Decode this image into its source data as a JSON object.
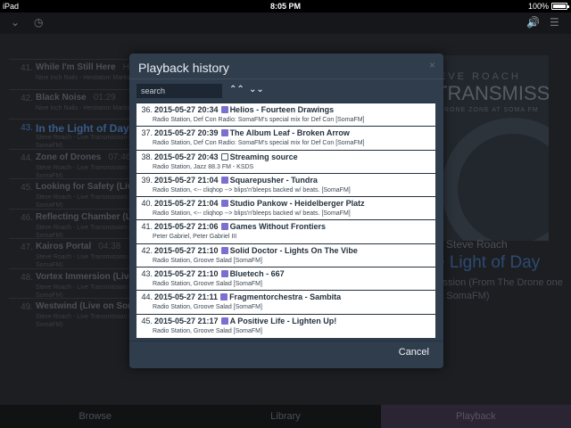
{
  "status_bar": {
    "device": "iPad",
    "time": "8:05 PM",
    "battery": "100%"
  },
  "toolbar": {
    "icons": [
      "chevron-down-icon",
      "clock-icon",
      "volume-icon",
      "menu-icon"
    ]
  },
  "tracks": [
    {
      "num": "41.",
      "title": "While I'm Still Here",
      "duration": "Here",
      "sub": "Nine Inch Nails - Hesitation Marks"
    },
    {
      "num": "42.",
      "title": "Black Noise",
      "duration": "01:29",
      "sub": "Nine Inch Nails - Hesitation Marks"
    },
    {
      "num": "43.",
      "title": "In the Light of Day",
      "duration": "",
      "sub": "Steve Roach - Live Transmission (From The Drone Zone at SomaFM)"
    },
    {
      "num": "44.",
      "title": "Zone of Drones",
      "duration": "07:46",
      "sub": "Steve Roach - Live Transmission (From The Drone Zone at SomaFM)"
    },
    {
      "num": "45.",
      "title": "Looking for Safety (Live on",
      "duration": "",
      "sub": "Steve Roach - Live Transmission (From The Drone Zone at SomaFM)"
    },
    {
      "num": "46.",
      "title": "Reflecting Chamber (Live o",
      "duration": "",
      "sub": "Steve Roach - Live Transmission (From The Drone Zone at SomaFM)"
    },
    {
      "num": "47.",
      "title": "Kairos Portal",
      "duration": "04:38",
      "sub": "Steve Roach - Live Transmission (From The Drone Zone at SomaFM)"
    },
    {
      "num": "48.",
      "title": "Vortex Immersion (Live on S",
      "duration": "",
      "sub": "Steve Roach - Live Transmission (From The Drone Zone at SomaFM)"
    },
    {
      "num": "49.",
      "title": "Westwind (Live on SomaFM)",
      "duration": "",
      "sub": "Steve Roach - Live Transmission (From The Drone Zone at SomaFM)"
    }
  ],
  "album_art": {
    "top": "EVE ROACH",
    "title": "TRANSMISSION",
    "sub": "DRONE ZONE AT SOMA FM"
  },
  "now_playing": {
    "artist": "Steve Roach",
    "title": "e Light of Day",
    "description": "nission (From The Drone one at SomaFM)"
  },
  "bottom_tabs": [
    "Browse",
    "Library",
    "Playback"
  ],
  "modal": {
    "title": "Playback history",
    "close": "×",
    "search_placeholder": "search",
    "sort_up": "⌃⌃",
    "sort_down": "⌄⌄",
    "cancel_label": "Cancel"
  },
  "history": [
    {
      "num": "36.",
      "timestamp": "2015-05-27 20:34",
      "icon": "music-icon",
      "title": "Helios - Fourteen Drawings",
      "source": "Radio Station, Def Con Radio: SomaFM's special mix for Def Con [SomaFM]"
    },
    {
      "num": "37.",
      "timestamp": "2015-05-27 20:39",
      "icon": "music-icon",
      "title": "The Album Leaf - Broken Arrow",
      "source": "Radio Station, Def Con Radio: SomaFM's special mix for Def Con [SomaFM]"
    },
    {
      "num": "38.",
      "timestamp": "2015-05-27 20:43",
      "icon": "external-link-icon",
      "title": "Streaming source",
      "source": "Radio Station, Jazz 88.3 FM - KSDS"
    },
    {
      "num": "39.",
      "timestamp": "2015-05-27 21:04",
      "icon": "music-icon",
      "title": "Squarepusher - Tundra",
      "source": "Radio Station, <-- cliqhop --> blips'n'bleeps backed w/ beats. [SomaFM]"
    },
    {
      "num": "40.",
      "timestamp": "2015-05-27 21:04",
      "icon": "music-icon",
      "title": "Studio Pankow - Heidelberger Platz",
      "source": "Radio Station, <-- cliqhop --> blips'n'bleeps backed w/ beats. [SomaFM]"
    },
    {
      "num": "41.",
      "timestamp": "2015-05-27 21:06",
      "icon": "music-icon",
      "title": "Games Without Frontiers",
      "source": "Peter Gabriel, Peter Gabriel III"
    },
    {
      "num": "42.",
      "timestamp": "2015-05-27 21:10",
      "icon": "music-icon",
      "title": "Solid Doctor - Lights On The Vibe",
      "source": "Radio Station, Groove Salad [SomaFM]"
    },
    {
      "num": "43.",
      "timestamp": "2015-05-27 21:10",
      "icon": "music-icon",
      "title": "Bluetech - 667",
      "source": "Radio Station, Groove Salad [SomaFM]"
    },
    {
      "num": "44.",
      "timestamp": "2015-05-27 21:11",
      "icon": "music-icon",
      "title": "Fragmentorchestra - Sambita",
      "source": "Radio Station, Groove Salad [SomaFM]"
    },
    {
      "num": "45.",
      "timestamp": "2015-05-27 21:17",
      "icon": "music-icon",
      "title": "A Positive Life - Lighten Up!",
      "source": "Radio Station, Groove Salad [SomaFM]"
    }
  ],
  "colors": {
    "modal_bg": "#2f3d4d",
    "accent_purple": "#7d6fd1",
    "current_track": "#3a5a88"
  }
}
